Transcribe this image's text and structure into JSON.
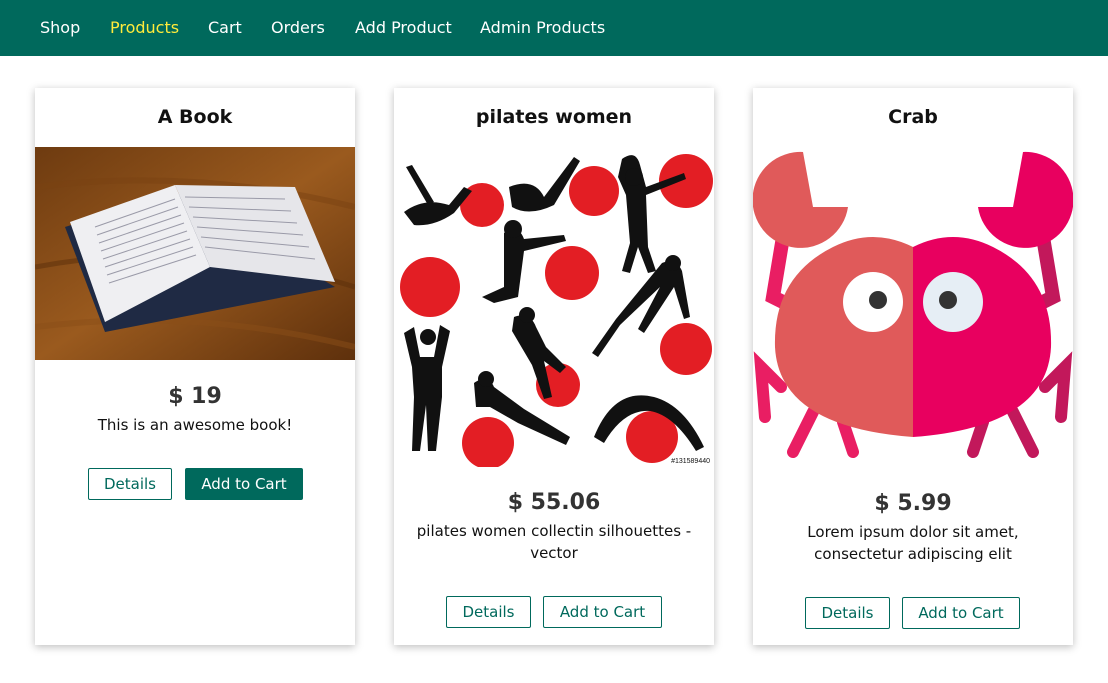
{
  "nav": {
    "items": [
      {
        "label": "Shop"
      },
      {
        "label": "Products"
      },
      {
        "label": "Cart"
      },
      {
        "label": "Orders"
      },
      {
        "label": "Add Product"
      },
      {
        "label": "Admin Products"
      }
    ],
    "active": "Products"
  },
  "colors": {
    "nav_bg": "#00695c",
    "nav_active": "#ffeb3b",
    "accent": "#00695c"
  },
  "products": [
    {
      "title": "A Book",
      "price": "$ 19",
      "description": "This is an awesome book!",
      "details_label": "Details",
      "add_label": "Add to Cart",
      "image": "open-book-photo"
    },
    {
      "title": "pilates women",
      "price": "$ 55.06",
      "description": "pilates women collectin silhouettes - vector",
      "details_label": "Details",
      "add_label": "Add to Cart",
      "image": "pilates-silhouettes",
      "image_caption": "#131589440"
    },
    {
      "title": "Crab",
      "price": "$ 5.99",
      "description": "Lorem ipsum dolor sit amet, consectetur adipiscing elit",
      "details_label": "Details",
      "add_label": "Add to Cart",
      "image": "crab-illustration"
    }
  ]
}
